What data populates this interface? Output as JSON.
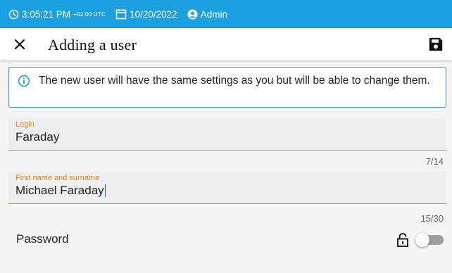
{
  "statusbar": {
    "time": "3:05:21 PM",
    "timezone": "+02:00 UTC",
    "date": "10/20/2022",
    "user": "Admin",
    "icons": [
      "clock-icon",
      "calendar-icon",
      "user-icon"
    ]
  },
  "header": {
    "title": "Adding a user",
    "close_icon": "close-icon",
    "save_icon": "save-icon"
  },
  "info": {
    "icon": "info-icon",
    "text": "The new user will have the same settings as you but will be able to change them."
  },
  "form": {
    "login": {
      "label": "Login",
      "value": "Faraday",
      "counter": "7/14"
    },
    "name": {
      "label": "First name and surname",
      "value": "Michael Faraday",
      "counter": "15/30"
    },
    "password": {
      "label": "Password",
      "lock_icon": "lock-open-icon",
      "enabled": false
    }
  },
  "colors": {
    "accent": "#1ba0e2",
    "active_label": "#f5830a",
    "background": "#f5f5f5"
  }
}
